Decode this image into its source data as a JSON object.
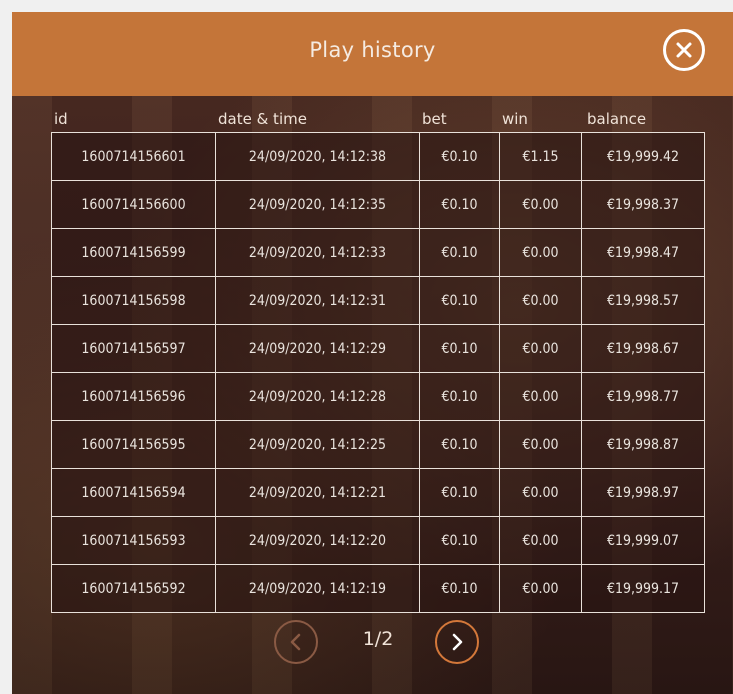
{
  "header": {
    "title": "Play history",
    "close_icon": "close-icon"
  },
  "columns": {
    "id": "id",
    "datetime": "date & time",
    "bet": "bet",
    "win": "win",
    "balance": "balance"
  },
  "rows": [
    {
      "id": "1600714156601",
      "datetime": "24/09/2020, 14:12:38",
      "bet": "€0.10",
      "win": "€1.15",
      "balance": "€19,999.42"
    },
    {
      "id": "1600714156600",
      "datetime": "24/09/2020, 14:12:35",
      "bet": "€0.10",
      "win": "€0.00",
      "balance": "€19,998.37"
    },
    {
      "id": "1600714156599",
      "datetime": "24/09/2020, 14:12:33",
      "bet": "€0.10",
      "win": "€0.00",
      "balance": "€19,998.47"
    },
    {
      "id": "1600714156598",
      "datetime": "24/09/2020, 14:12:31",
      "bet": "€0.10",
      "win": "€0.00",
      "balance": "€19,998.57"
    },
    {
      "id": "1600714156597",
      "datetime": "24/09/2020, 14:12:29",
      "bet": "€0.10",
      "win": "€0.00",
      "balance": "€19,998.67"
    },
    {
      "id": "1600714156596",
      "datetime": "24/09/2020, 14:12:28",
      "bet": "€0.10",
      "win": "€0.00",
      "balance": "€19,998.77"
    },
    {
      "id": "1600714156595",
      "datetime": "24/09/2020, 14:12:25",
      "bet": "€0.10",
      "win": "€0.00",
      "balance": "€19,998.87"
    },
    {
      "id": "1600714156594",
      "datetime": "24/09/2020, 14:12:21",
      "bet": "€0.10",
      "win": "€0.00",
      "balance": "€19,998.97"
    },
    {
      "id": "1600714156593",
      "datetime": "24/09/2020, 14:12:20",
      "bet": "€0.10",
      "win": "€0.00",
      "balance": "€19,999.07"
    },
    {
      "id": "1600714156592",
      "datetime": "24/09/2020, 14:12:19",
      "bet": "€0.10",
      "win": "€0.00",
      "balance": "€19,999.17"
    }
  ],
  "pagination": {
    "page_text": "1/2",
    "prev_icon": "chevron-left-icon",
    "next_icon": "chevron-right-icon"
  },
  "colors": {
    "header_bg": "#c47539",
    "accent": "#d4783a",
    "panel_bg": "#3a1d1a",
    "text": "#f0e3d8"
  }
}
